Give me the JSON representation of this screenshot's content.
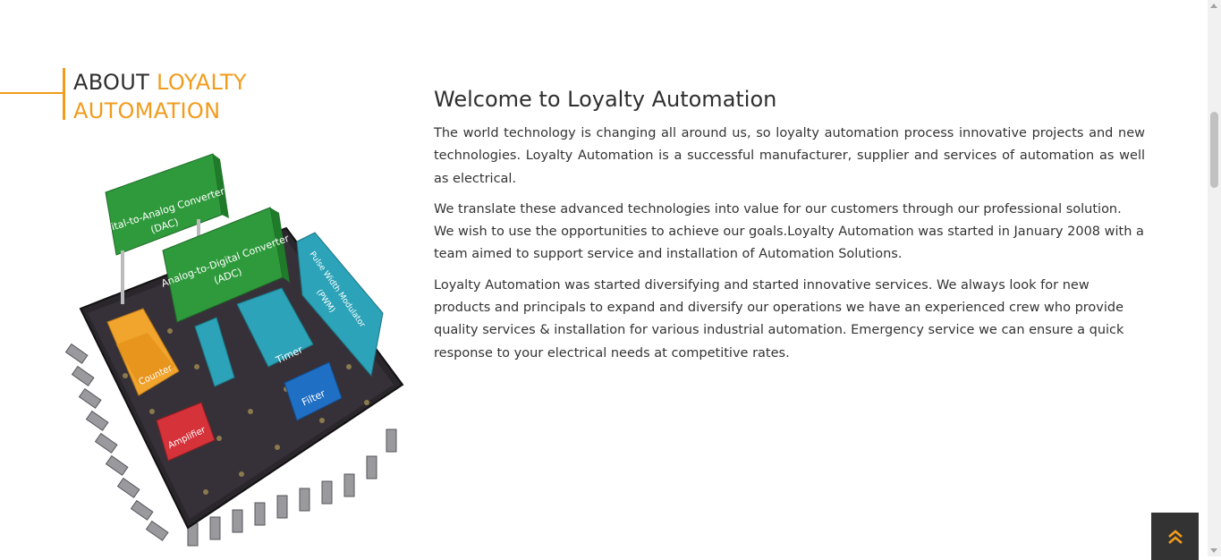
{
  "about": {
    "title_part1": "ABOUT",
    "title_part2": "LOYALTY",
    "title_part3": "AUTOMATION"
  },
  "illustration": {
    "labels": {
      "dac_line1": "Digital-to-Analog Converter",
      "dac_line2": "(DAC)",
      "adc_line1": "Analog-to-Digital Converter",
      "adc_line2": "(ADC)",
      "pwm_line1": "Pulse Width Modulator",
      "pwm_line2": "(PWM)",
      "counter": "Counter",
      "timer": "Timer",
      "filter": "Filter",
      "amplifier": "Amplifier"
    }
  },
  "main": {
    "title": "Welcome to Loyalty Automation",
    "para1": "The world technology is changing all around us, so loyalty automation process innovative projects and new technologies. Loyalty Automation is a successful manufacturer, supplier and services of automation as well as electrical.",
    "para2": "We translate these advanced technologies into value for our customers through our professional solution. We wish to use the opportunities to achieve our goals.Loyalty Automation was started in January 2008 with a team aimed to support service and installation of Automation Solutions.",
    "para3": "Loyalty Automation was started diversifying and started innovative services. We always look for new products and principals to expand and diversify our operations we have an experienced crew who provide quality services & installation for various industrial automation. Emergency service we can ensure a quick response to your electrical needs at competitive rates."
  },
  "colors": {
    "accent": "#f19c1c",
    "heading": "#2f2f2f",
    "back_to_top_bg": "#333333"
  },
  "icons": {
    "back_to_top": "double-chevron-up-icon"
  }
}
